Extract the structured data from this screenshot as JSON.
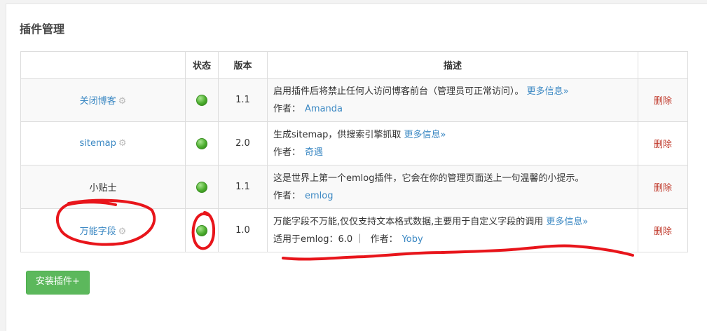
{
  "page": {
    "title": "插件管理"
  },
  "table": {
    "headers": {
      "name": "",
      "status": "状态",
      "version": "版本",
      "description": "描述",
      "action": ""
    },
    "rows": [
      {
        "name": "关闭博客",
        "name_link": true,
        "has_settings": true,
        "status": "enabled",
        "version": "1.1",
        "description": "启用插件后将禁止任何人访问博客前台（管理员可正常访问）。",
        "more_link": "更多信息»",
        "compat": "",
        "author_label": "作者：",
        "author": "Amanda",
        "action": "删除"
      },
      {
        "name": "sitemap",
        "name_link": true,
        "has_settings": true,
        "status": "enabled",
        "version": "2.0",
        "description": "生成sitemap，供搜索引擎抓取",
        "more_link": "更多信息»",
        "compat": "",
        "author_label": "作者：",
        "author": "奇遇",
        "action": "删除"
      },
      {
        "name": "小贴士",
        "name_link": false,
        "has_settings": false,
        "status": "enabled",
        "version": "1.1",
        "description": "这是世界上第一个emlog插件，它会在你的管理页面送上一句温馨的小提示。",
        "more_link": "",
        "compat": "",
        "author_label": "作者：",
        "author": "emlog",
        "action": "删除"
      },
      {
        "name": "万能字段",
        "name_link": true,
        "has_settings": true,
        "status": "enabled",
        "version": "1.0",
        "description": "万能字段不万能,仅仅支持文本格式数据,主要用于自定义字段的调用",
        "more_link": "更多信息»",
        "compat": "适用于emlog：6.0 ｜",
        "author_label": "作者：",
        "author": "Yoby",
        "action": "删除"
      }
    ]
  },
  "buttons": {
    "install": "安装插件+"
  },
  "colors": {
    "link": "#3b88c3",
    "delete": "#c0392b",
    "button": "#5cb85c",
    "status_on": "#4cae2e",
    "annotation": "#e8151b"
  },
  "icons": {
    "settings": "gear-icon",
    "status": "status-dot-icon"
  }
}
